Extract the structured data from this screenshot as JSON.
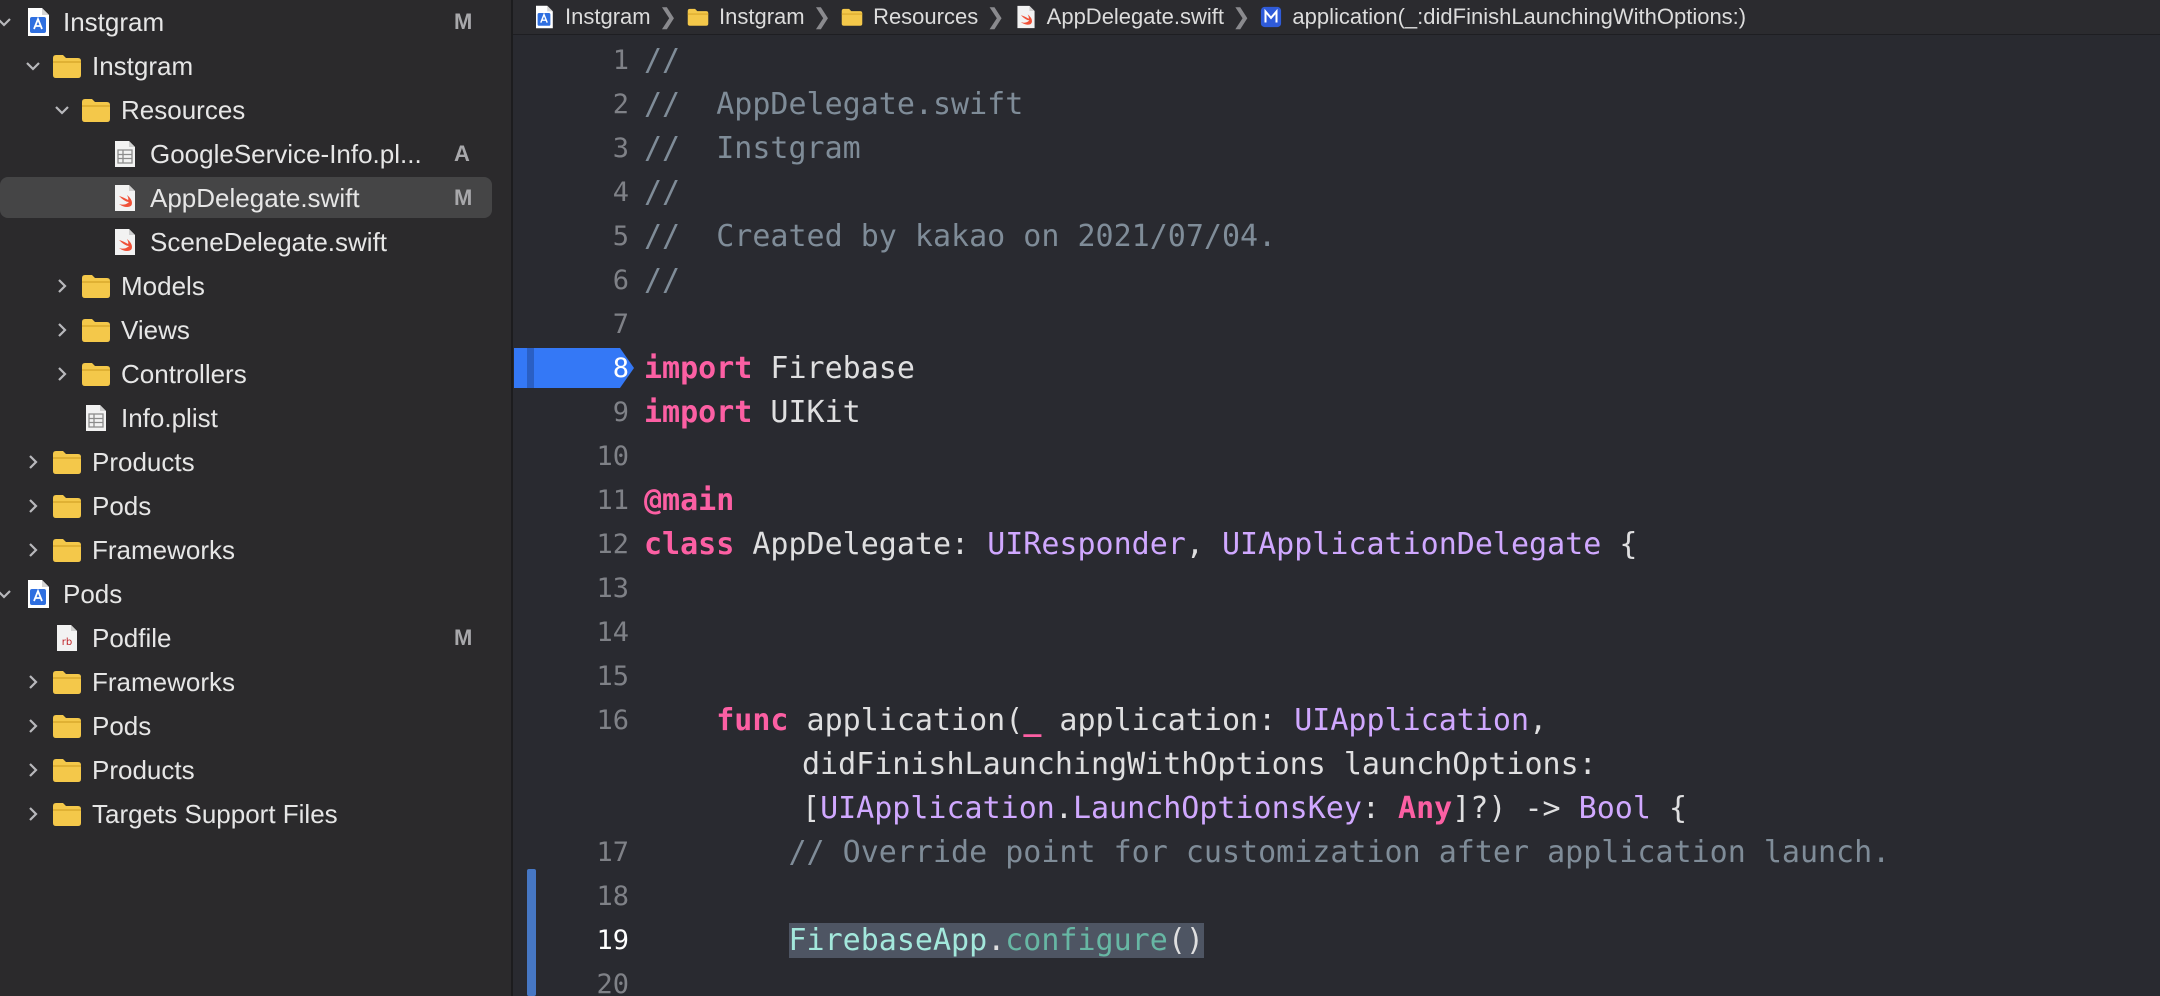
{
  "navigator": {
    "items": [
      {
        "label": "Instgram",
        "icon": "project-icon",
        "chevron": "down",
        "badge": "M"
      },
      {
        "label": "Instgram",
        "icon": "folder-icon",
        "chevron": "down",
        "badge": ""
      },
      {
        "label": "Resources",
        "icon": "folder-icon",
        "chevron": "down",
        "badge": ""
      },
      {
        "label": "GoogleService-Info.pl...",
        "icon": "plist-file-icon",
        "chevron": "",
        "badge": "A"
      },
      {
        "label": "AppDelegate.swift",
        "icon": "swift-file-icon",
        "chevron": "",
        "badge": "M",
        "selected": true
      },
      {
        "label": "SceneDelegate.swift",
        "icon": "swift-file-icon",
        "chevron": "",
        "badge": ""
      },
      {
        "label": "Models",
        "icon": "folder-icon",
        "chevron": "right",
        "badge": ""
      },
      {
        "label": "Views",
        "icon": "folder-icon",
        "chevron": "right",
        "badge": ""
      },
      {
        "label": "Controllers",
        "icon": "folder-icon",
        "chevron": "right",
        "badge": ""
      },
      {
        "label": "Info.plist",
        "icon": "plist-file-icon",
        "chevron": "",
        "badge": ""
      },
      {
        "label": "Products",
        "icon": "folder-icon",
        "chevron": "right",
        "badge": ""
      },
      {
        "label": "Pods",
        "icon": "folder-icon",
        "chevron": "right",
        "badge": ""
      },
      {
        "label": "Frameworks",
        "icon": "folder-icon",
        "chevron": "right",
        "badge": ""
      },
      {
        "label": "Pods",
        "icon": "project-icon",
        "chevron": "down",
        "badge": ""
      },
      {
        "label": "Podfile",
        "icon": "ruby-file-icon",
        "chevron": "",
        "badge": "M"
      },
      {
        "label": "Frameworks",
        "icon": "folder-icon",
        "chevron": "right",
        "badge": ""
      },
      {
        "label": "Pods",
        "icon": "folder-icon",
        "chevron": "right",
        "badge": ""
      },
      {
        "label": "Products",
        "icon": "folder-icon",
        "chevron": "right",
        "badge": ""
      },
      {
        "label": "Targets Support Files",
        "icon": "folder-icon",
        "chevron": "right",
        "badge": ""
      }
    ]
  },
  "jumpbar": {
    "crumbs": [
      {
        "label": "Instgram",
        "icon": "project-icon"
      },
      {
        "label": "Instgram",
        "icon": "folder-icon"
      },
      {
        "label": "Resources",
        "icon": "folder-icon"
      },
      {
        "label": "AppDelegate.swift",
        "icon": "swift-file-icon"
      },
      {
        "label": "application(_:didFinishLaunchingWithOptions:)",
        "icon": "method-icon"
      }
    ],
    "method_badge": "M"
  },
  "editor": {
    "current_line": "19",
    "breakpoint_line": "8",
    "lines": [
      {
        "num": "1",
        "tokens": [
          {
            "t": "//",
            "c": "comment"
          }
        ]
      },
      {
        "num": "2",
        "tokens": [
          {
            "t": "//  AppDelegate.swift",
            "c": "comment"
          }
        ]
      },
      {
        "num": "3",
        "tokens": [
          {
            "t": "//  Instgram",
            "c": "comment"
          }
        ]
      },
      {
        "num": "4",
        "tokens": [
          {
            "t": "//",
            "c": "comment"
          }
        ]
      },
      {
        "num": "5",
        "tokens": [
          {
            "t": "//  Created by kakao on 2021/07/04.",
            "c": "comment"
          }
        ]
      },
      {
        "num": "6",
        "tokens": [
          {
            "t": "//",
            "c": "comment"
          }
        ]
      },
      {
        "num": "7",
        "tokens": []
      },
      {
        "num": "8",
        "tokens": [
          {
            "t": "import",
            "c": "keyword"
          },
          {
            "t": " Firebase",
            "c": "plain"
          }
        ]
      },
      {
        "num": "9",
        "tokens": [
          {
            "t": "import",
            "c": "keyword"
          },
          {
            "t": " UIKit",
            "c": "plain"
          }
        ]
      },
      {
        "num": "10",
        "tokens": []
      },
      {
        "num": "11",
        "tokens": [
          {
            "t": "@main",
            "c": "keyword"
          }
        ]
      },
      {
        "num": "12",
        "tokens": [
          {
            "t": "class",
            "c": "keyword"
          },
          {
            "t": " AppDelegate: ",
            "c": "plain"
          },
          {
            "t": "UIResponder",
            "c": "type"
          },
          {
            "t": ", ",
            "c": "plain"
          },
          {
            "t": "UIApplicationDelegate",
            "c": "type"
          },
          {
            "t": " {",
            "c": "plain"
          }
        ]
      },
      {
        "num": "13",
        "tokens": []
      },
      {
        "num": "14",
        "tokens": []
      },
      {
        "num": "15",
        "tokens": []
      },
      {
        "num": "16",
        "tokens": [
          {
            "t": "    ",
            "c": "plain"
          },
          {
            "t": "func",
            "c": "keyword"
          },
          {
            "t": " application(",
            "c": "plain"
          },
          {
            "t": "_",
            "c": "keyword"
          },
          {
            "t": " application: ",
            "c": "plain"
          },
          {
            "t": "UIApplication",
            "c": "type"
          },
          {
            "t": ",",
            "c": "plain"
          }
        ]
      },
      {
        "num": "",
        "cont": true,
        "tokens": [
          {
            "t": "didFinishLaunchingWithOptions launchOptions:",
            "c": "plain"
          }
        ]
      },
      {
        "num": "",
        "cont": true,
        "tokens": [
          {
            "t": "[",
            "c": "plain"
          },
          {
            "t": "UIApplication",
            "c": "type"
          },
          {
            "t": ".",
            "c": "plain"
          },
          {
            "t": "LaunchOptionsKey",
            "c": "type"
          },
          {
            "t": ": ",
            "c": "plain"
          },
          {
            "t": "Any",
            "c": "keyword"
          },
          {
            "t": "]?) -> ",
            "c": "plain"
          },
          {
            "t": "Bool",
            "c": "type"
          },
          {
            "t": " {",
            "c": "plain"
          }
        ]
      },
      {
        "num": "17",
        "tokens": [
          {
            "t": "        // Override point for customization after application launch.",
            "c": "comment"
          }
        ]
      },
      {
        "num": "18",
        "tokens": []
      },
      {
        "num": "19",
        "tokens": [
          {
            "t": "        ",
            "c": "plain"
          },
          {
            "t": "FirebaseApp",
            "c": "other-class",
            "hl": true
          },
          {
            "t": ".",
            "c": "plain",
            "hl": true
          },
          {
            "t": "configure",
            "c": "other-func",
            "hl": true
          },
          {
            "t": "()",
            "c": "plain",
            "hl": true
          }
        ]
      },
      {
        "num": "20",
        "tokens": []
      }
    ]
  },
  "colors": {
    "accent": "#3478f6",
    "keyword": "#fc5fa3",
    "type": "#d0a8ff",
    "comment": "#7f8c98",
    "folder": "#f4c84a"
  }
}
